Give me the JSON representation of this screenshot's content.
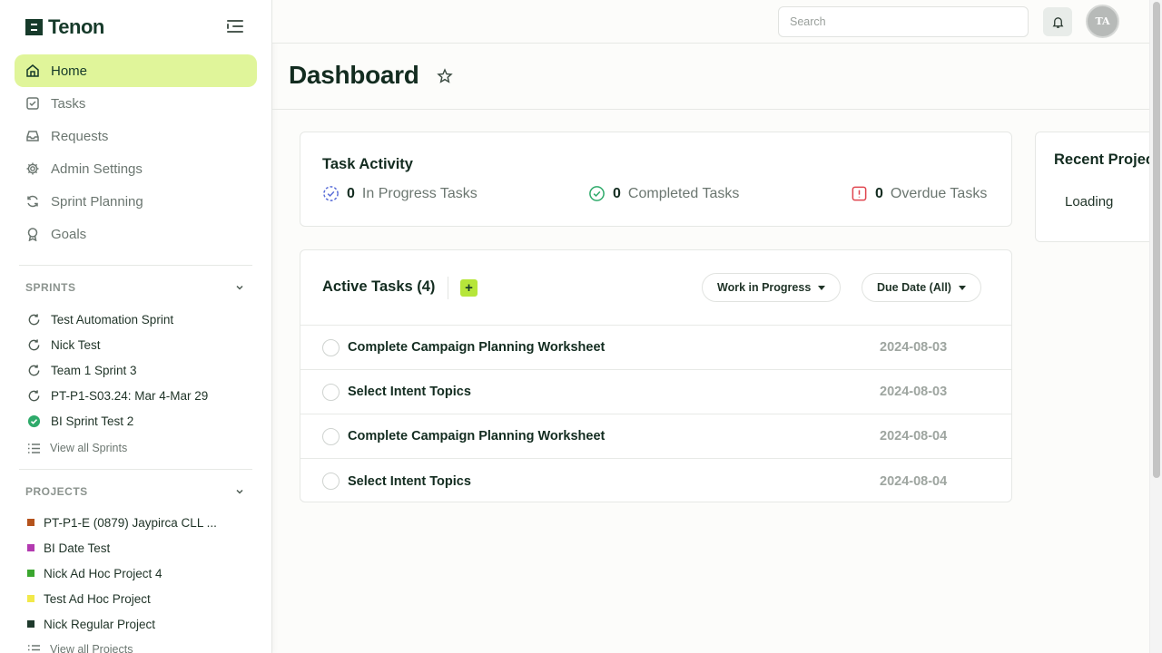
{
  "brand": {
    "name": "Tenon"
  },
  "nav": [
    {
      "label": "Home",
      "icon": "home-icon",
      "active": true
    },
    {
      "label": "Tasks",
      "icon": "task-check-icon"
    },
    {
      "label": "Requests",
      "icon": "inbox-icon"
    },
    {
      "label": "Admin Settings",
      "icon": "gear-icon"
    },
    {
      "label": "Sprint Planning",
      "icon": "sync-icon"
    },
    {
      "label": "Goals",
      "icon": "award-icon"
    }
  ],
  "sprints": {
    "heading": "SPRINTS",
    "items": [
      {
        "label": "Test Automation Sprint",
        "status": "in-progress"
      },
      {
        "label": "Nick Test",
        "status": "in-progress"
      },
      {
        "label": "Team 1 Sprint 3",
        "status": "in-progress"
      },
      {
        "label": "PT-P1-S03.24: Mar 4-Mar 29",
        "status": "in-progress"
      },
      {
        "label": "BI Sprint Test 2",
        "status": "complete"
      }
    ],
    "view_all": "View all Sprints"
  },
  "projects": {
    "heading": "PROJECTS",
    "items": [
      {
        "label": "PT-P1-E (0879) Jaypirca CLL ...",
        "color": "#b5531c"
      },
      {
        "label": "BI Date Test",
        "color": "#b33ab0"
      },
      {
        "label": "Nick Ad Hoc Project 4",
        "color": "#3aa62e"
      },
      {
        "label": "Test Ad Hoc Project",
        "color": "#f2e94a"
      },
      {
        "label": "Nick Regular Project",
        "color": "#1f3a2c"
      }
    ],
    "view_all": "View all Projects"
  },
  "topbar": {
    "search_placeholder": "Search",
    "avatar_initials": "TA"
  },
  "page": {
    "title": "Dashboard"
  },
  "task_activity": {
    "title": "Task Activity",
    "stats": [
      {
        "count": "0",
        "label": "In Progress Tasks",
        "color": "#5b6fd8"
      },
      {
        "count": "0",
        "label": "Completed Tasks",
        "color": "#2eaa6a"
      },
      {
        "count": "0",
        "label": "Overdue Tasks",
        "color": "#e0454f"
      }
    ]
  },
  "recent_projects": {
    "title": "Recent Projects",
    "status": "Loading"
  },
  "active_tasks": {
    "title": "Active Tasks (4)",
    "add_label": "+",
    "filters": [
      "Work in Progress",
      "Due Date (All)"
    ],
    "rows": [
      {
        "name": "Complete Campaign Planning Worksheet",
        "date": "2024-08-03"
      },
      {
        "name": "Select Intent Topics",
        "date": "2024-08-03"
      },
      {
        "name": "Complete Campaign Planning Worksheet",
        "date": "2024-08-04"
      },
      {
        "name": "Select Intent Topics",
        "date": "2024-08-04"
      }
    ]
  },
  "colors": {
    "brand": "#163a2a",
    "active_nav": "#e0f59a",
    "accent": "#b6e63a"
  }
}
